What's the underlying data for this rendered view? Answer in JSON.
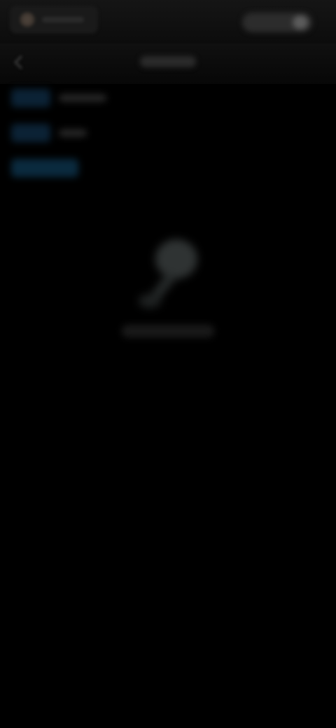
{
  "header": {
    "account_label": "",
    "action_label": ""
  },
  "navbar": {
    "title": ""
  },
  "quick_list": [
    {
      "badge": "",
      "label": ""
    },
    {
      "badge": "",
      "label": ""
    },
    {
      "badge": "",
      "label": ""
    }
  ],
  "empty_state": {
    "message": ""
  },
  "colors": {
    "background": "#000000",
    "badge_blue": "#0b2235"
  },
  "icons": {
    "back": "chevron-left-icon",
    "empty": "broom-icon"
  }
}
